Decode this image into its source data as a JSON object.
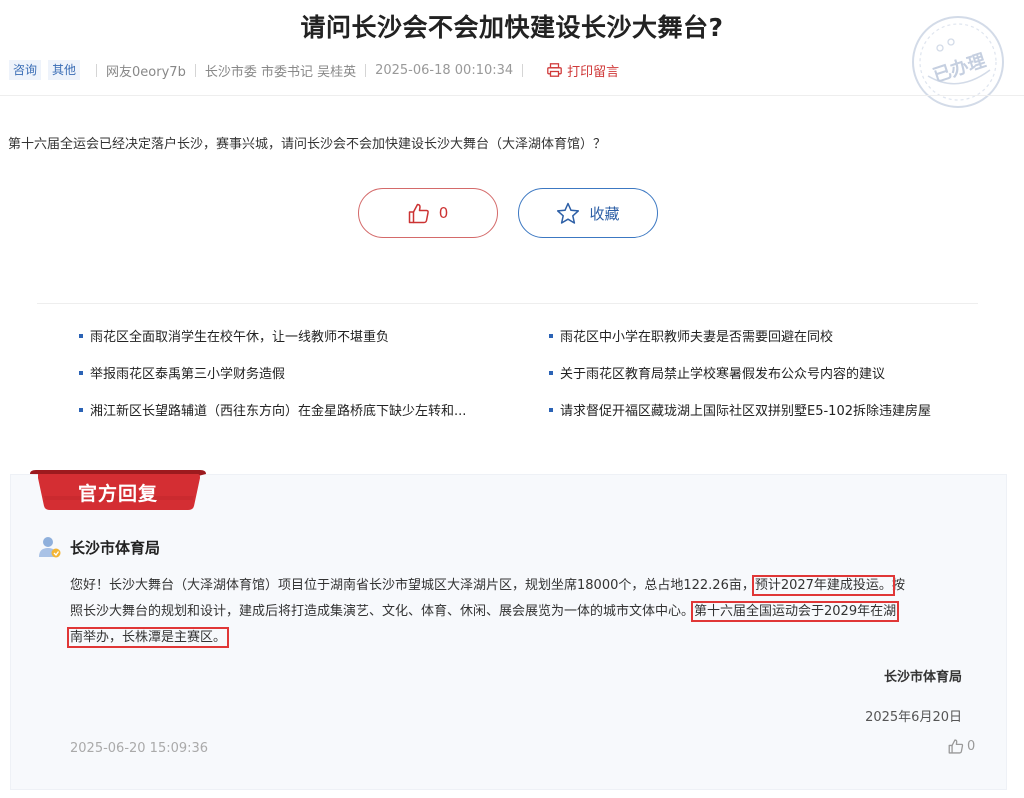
{
  "title": "请问长沙会不会加快建设长沙大舞台?",
  "meta": {
    "tags": [
      "咨询",
      "其他"
    ],
    "author": "网友0eory7b",
    "recipient": "长沙市委 市委书记 吴桂英",
    "datetime": "2025-06-18 00:10:34",
    "print_label": "打印留言"
  },
  "stamp": {
    "text": "已办理",
    "color": "#c5cfe0",
    "icon": "processed-stamp"
  },
  "content": "第十六届全运会已经决定落户长沙，赛事兴城，请问长沙会不会加快建设长沙大舞台（大泽湖体育馆）？",
  "actions": {
    "like_count": "0",
    "favorite_label": "收藏"
  },
  "related": [
    "雨花区全面取消学生在校午休，让一线教师不堪重负",
    "雨花区中小学在职教师夫妻是否需要回避在同校",
    "举报雨花区泰禹第三小学财务造假",
    "关于雨花区教育局禁止学校寒暑假发布公众号内容的建议",
    "湘江新区长望路辅道（西往东方向）在金星路桥底下缺少左转和...",
    "请求督促开福区藏珑湖上国际社区双拼别墅E5-102拆除违建房屋"
  ],
  "reply": {
    "tab_label": "官方回复",
    "department": "长沙市体育局",
    "line1_a": "您好！长沙大舞台（大泽湖体育馆）项目位于湖南省长沙市望城区大泽湖片区，规划坐席18000个，总占地122.26亩，",
    "line1_hl": "预计2027年建成投运。",
    "line1_b": "按",
    "line2_a": "照长沙大舞台的规划和设计，建成后将打造成集演艺、文化、体育、休闲、展会展览为一体的城市文体中心。",
    "line2_hl": "第十六届全国运动会于2029年在湖",
    "line3_hl": "南举办，长株潭是主赛区。",
    "signature": "长沙市体育局",
    "signature_date": "2025年6月20日",
    "reply_time": "2025-06-20 15:09:36",
    "like_count": "0"
  },
  "colors": {
    "accent_blue": "#2d5fa6",
    "like_red": "#c33",
    "tab_red": "#c8262b",
    "highlight_red": "#e03737"
  }
}
